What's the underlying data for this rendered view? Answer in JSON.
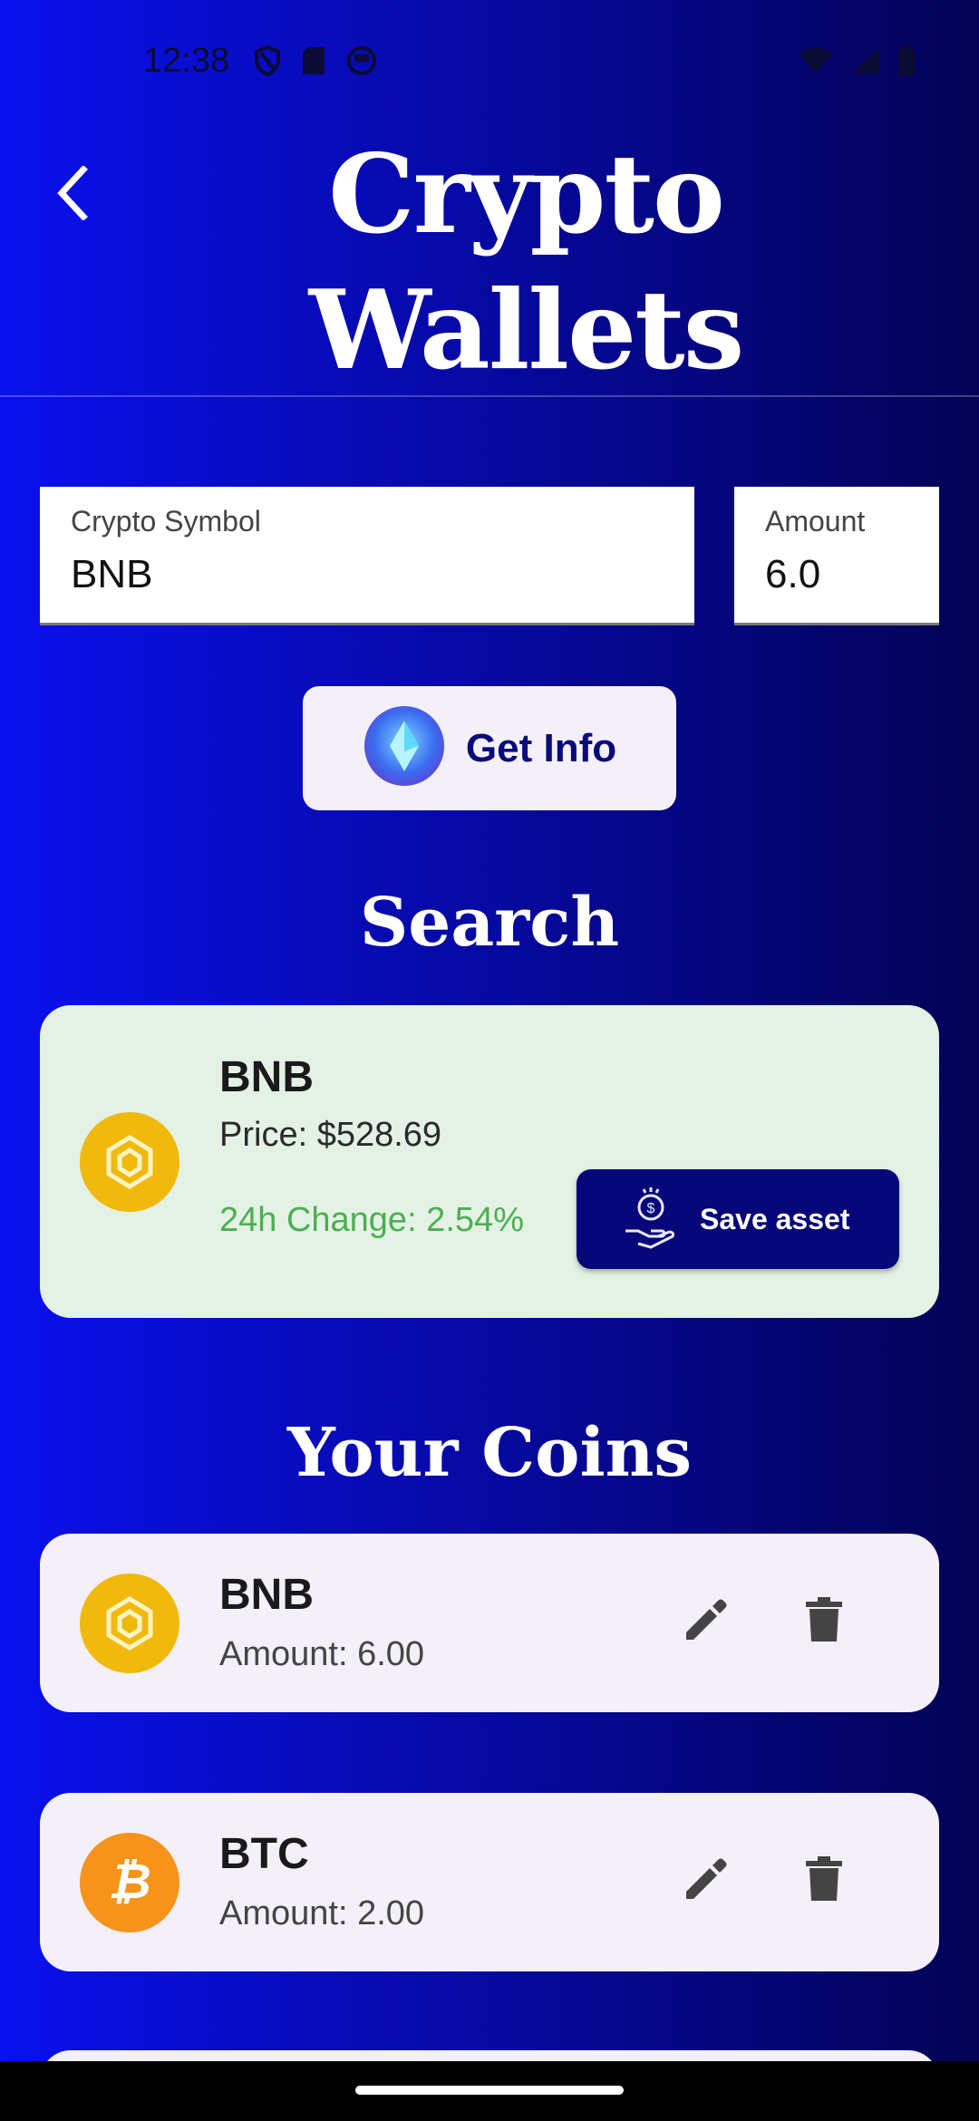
{
  "status_bar": {
    "time": "12:38"
  },
  "header": {
    "title": "Crypto Wallets"
  },
  "form": {
    "symbol_label": "Crypto Symbol",
    "symbol_value": "BNB",
    "amount_label": "Amount",
    "amount_value": "6.0",
    "get_info_label": "Get Info"
  },
  "search": {
    "section_title": "Search",
    "result": {
      "symbol": "BNB",
      "price": "Price: $528.69",
      "change": "24h Change: 2.54%",
      "save_label": "Save asset"
    }
  },
  "coins": {
    "section_title": "Your Coins",
    "items": [
      {
        "symbol": "BNB",
        "amount": "Amount: 6.00",
        "logo": "bnb-logo-icon"
      },
      {
        "symbol": "BTC",
        "amount": "Amount: 2.00",
        "logo": "btc-logo-icon"
      }
    ]
  },
  "colors": {
    "bg_left": "#0a10ee",
    "bg_right": "#030255",
    "accent_button": "#07077a",
    "change_positive": "#4caf50",
    "bnb": "#f0b90b",
    "btc": "#f7931a"
  }
}
